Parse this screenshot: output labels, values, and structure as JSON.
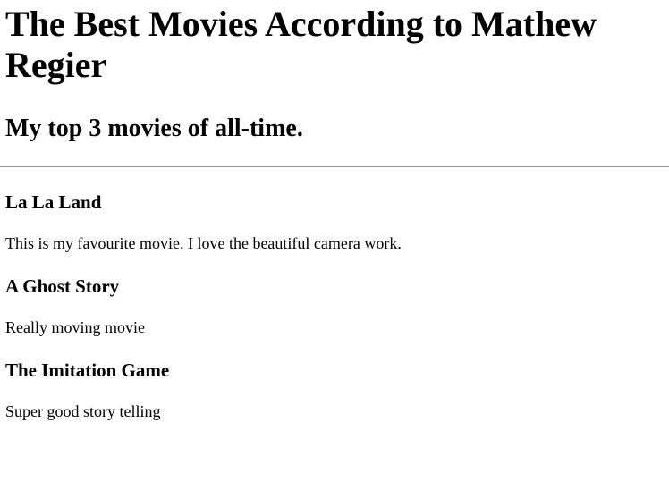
{
  "header": {
    "title": "The Best Movies According to Mathew Regier",
    "subtitle": "My top 3 movies of all-time."
  },
  "movies": [
    {
      "title": "La La Land",
      "description": "This is my favourite movie. I love the beautiful camera work."
    },
    {
      "title": "A Ghost Story",
      "description": "Really moving movie"
    },
    {
      "title": "The Imitation Game",
      "description": "Super good story telling"
    }
  ]
}
